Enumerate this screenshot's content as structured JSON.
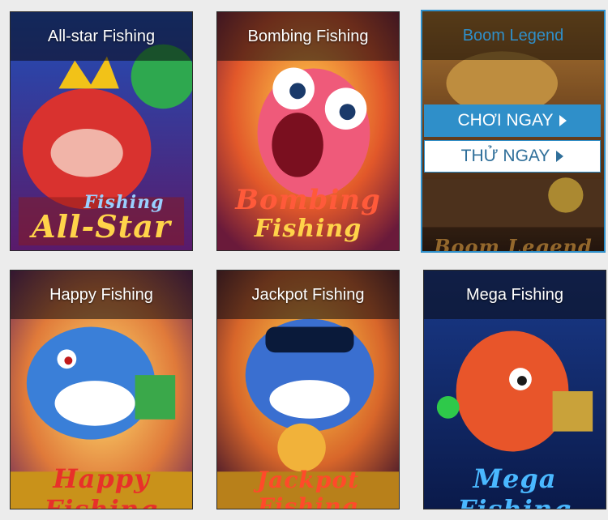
{
  "games": [
    {
      "title": "All-star Fishing",
      "logo_line1": "Fishing",
      "logo_line2": "All-Star"
    },
    {
      "title": "Bombing Fishing",
      "logo_line1": "Bombing",
      "logo_line2": "Fishing"
    },
    {
      "title": "Boom Legend",
      "logo_line1": "Boom Legend",
      "play_label": "CHƠI NGAY",
      "try_label": "THỬ NGAY"
    },
    {
      "title": "Happy Fishing",
      "logo_line1": "Happy Fishing"
    },
    {
      "title": "Jackpot Fishing",
      "logo_line1": "Jackpot Fishing"
    },
    {
      "title": "Mega Fishing",
      "logo_line1": "Mega Fishing"
    }
  ],
  "colors": {
    "accent": "#2f8fc9",
    "page_bg": "#ececec"
  }
}
